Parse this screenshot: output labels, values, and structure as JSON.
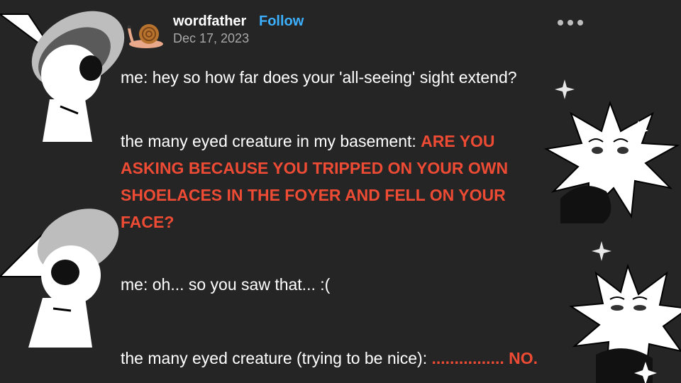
{
  "post": {
    "username": "wordfather",
    "follow_label": "Follow",
    "date": "Dec 17, 2023",
    "lines": [
      {
        "text": "me: hey so how far does your 'all-seeing' sight extend?"
      },
      {
        "prefix": "the many eyed creature in my basement: ",
        "loud": "ARE YOU ASKING BECAUSE YOU TRIPPED ON YOUR OWN SHOELACES IN THE FOYER AND FELL ON YOUR FACE?"
      },
      {
        "text": "me: oh... so you saw that... :("
      },
      {
        "prefix": "the many eyed creature (trying to be nice): ",
        "loud": "................ NO."
      }
    ]
  },
  "icons": {
    "avatar": "snail-avatar",
    "more": "more-options-icon"
  },
  "colors": {
    "background": "#252525",
    "follow": "#3cb0ff",
    "loud_text": "#ee4b35",
    "date": "#a8a8a8"
  }
}
